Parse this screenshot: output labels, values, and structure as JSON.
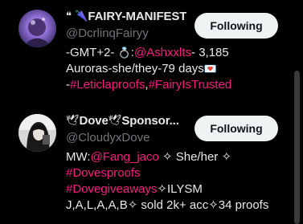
{
  "users": [
    {
      "display_name_prefix": "❝ 🌂 ",
      "display_name": "FAIRY-MANIFESTI...",
      "handle": "@DcrlinqFairyy",
      "follow_label": "Following",
      "bio": {
        "line1_a": "-GMT+2- ",
        "line1_ring": "💍",
        "line1_b": ":",
        "line1_mention": "@Ashxxlts",
        "line1_c": "- 3,185",
        "line2_a": "Auroras-she/they-79 days",
        "line2_heart": "💌",
        "line3_a": "-",
        "line3_tag1": "#Leticlaproofs",
        "line3_b": ",",
        "line3_tag2": "#FairyIsTrusted"
      }
    },
    {
      "display_name_prefix": "🕊",
      "display_name": "Dove",
      "display_name_mid": "🕊",
      "display_name_b": "Sponsor...",
      "handle": "@CloudyxDove",
      "follow_label": "Following",
      "bio": {
        "line1_a": "MW:",
        "line1_mention": "@Fang_jaco",
        "line1_b": " ✧ She/her ✧",
        "line2_tag": "#Dovesproofs",
        "line3_tag": "#Dovegiveaways",
        "line3_b": "✧ILYSM",
        "line4_a": "J,A,L,A,A,B✧ sold 2k+ acc✧34 proofs"
      }
    }
  ],
  "colors": {
    "background": "#000000",
    "text": "#e7e9ea",
    "secondary": "#71767b",
    "accent": "#f91880",
    "button_bg": "#eff3f4"
  }
}
